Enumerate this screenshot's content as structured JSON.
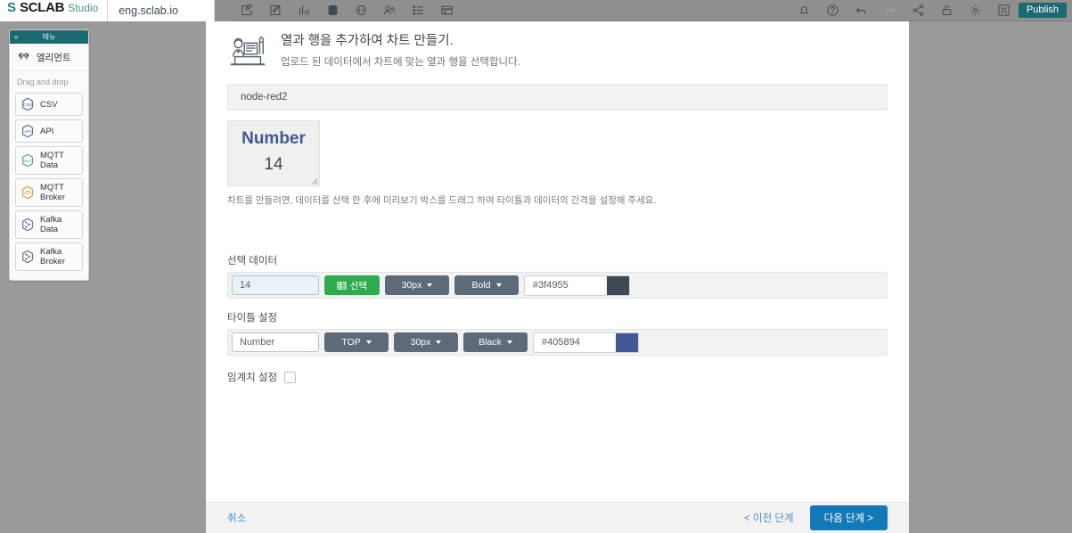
{
  "topbar": {
    "brand_mark": "S",
    "brand_name": "SCLAB",
    "brand_sub": "Studio",
    "site_name": "eng.sclab.io",
    "left_icons": [
      {
        "name": "edit-square-icon",
        "label": "edit"
      },
      {
        "name": "edit-pen-icon",
        "label": "annotate"
      },
      {
        "name": "chart-icon",
        "label": "chart"
      },
      {
        "name": "database-icon",
        "label": "database"
      },
      {
        "name": "code-icon",
        "label": "code"
      },
      {
        "name": "users-icon",
        "label": "users"
      },
      {
        "name": "list-icon",
        "label": "list"
      },
      {
        "name": "layout-icon",
        "label": "layout"
      }
    ],
    "right_icons": [
      {
        "name": "bell-icon",
        "label": "notifications"
      },
      {
        "name": "help-icon",
        "label": "help"
      },
      {
        "name": "undo-icon",
        "label": "undo"
      },
      {
        "name": "redo-icon",
        "label": "redo"
      },
      {
        "name": "share-icon",
        "label": "share"
      },
      {
        "name": "lock-open-icon",
        "label": "lock"
      },
      {
        "name": "gear-icon",
        "label": "settings"
      },
      {
        "name": "fullscreen-icon",
        "label": "fullscreen"
      }
    ],
    "publish_label": "Publish",
    "publish_color": "#1b6a72"
  },
  "sidebar": {
    "header_title": "메뉴",
    "collapse_icon": "«",
    "element_label": "엘리먼트",
    "dragdrop_label": "Drag and drop",
    "items": [
      {
        "label": "CSV",
        "icon": "csv-badge-icon",
        "color": "#3b5b8c"
      },
      {
        "label": "API",
        "icon": "api-badge-icon",
        "color": "#3b5b8c"
      },
      {
        "label": "MQTT Data",
        "icon": "mqtt-data-badge-icon",
        "color": "#3f9c5a"
      },
      {
        "label": "MQTT Broker",
        "icon": "mqtt-broker-badge-icon",
        "color": "#e08a2e"
      },
      {
        "label": "Kafka Data",
        "icon": "kafka-data-badge-icon",
        "color": "#4a5fb0"
      },
      {
        "label": "Kafka Broker",
        "icon": "kafka-broker-badge-icon",
        "color": "#5a5a5a"
      }
    ]
  },
  "modal": {
    "icon_name": "person-at-desk-icon",
    "title": "열과 행을 추가하여 차트 만들기.",
    "subtitle": "업로드 된 데이터에서 차트에 맞는 열과 행을 선택합니다.",
    "sheet_name": "node-red2",
    "preview": {
      "title_text": "Number",
      "value_text": "14",
      "title_color": "#405894",
      "value_color": "#3f4955"
    },
    "helper_text": "차트를 만들려면, 데이터를 선택 한 후에 미리보기 박스를 드래그 하여 타이틀과 데이터의 간격을 설정해 주세요.",
    "data_section": {
      "label": "선택 데이터",
      "input_value": "14",
      "input_placeholder": "14",
      "select_button_label": "선택",
      "select_button_icon": "table-grid-icon",
      "font_size": "30px",
      "font_weight": "Bold",
      "color_hex": "#3f4955",
      "color_swatch": "#3f4955"
    },
    "title_section": {
      "label": "타이틀 설정",
      "input_value": "Number",
      "input_placeholder": "Number",
      "position": "TOP",
      "font_size": "30px",
      "font_weight": "Black",
      "color_hex": "#405894",
      "color_swatch": "#405894"
    },
    "threshold": {
      "label": "임계치 설정",
      "checked": false
    },
    "footer": {
      "cancel_label": "취소",
      "prev_label": "< 이전 단계",
      "next_label": "다음 단계 >",
      "next_color": "#1479b8"
    }
  }
}
